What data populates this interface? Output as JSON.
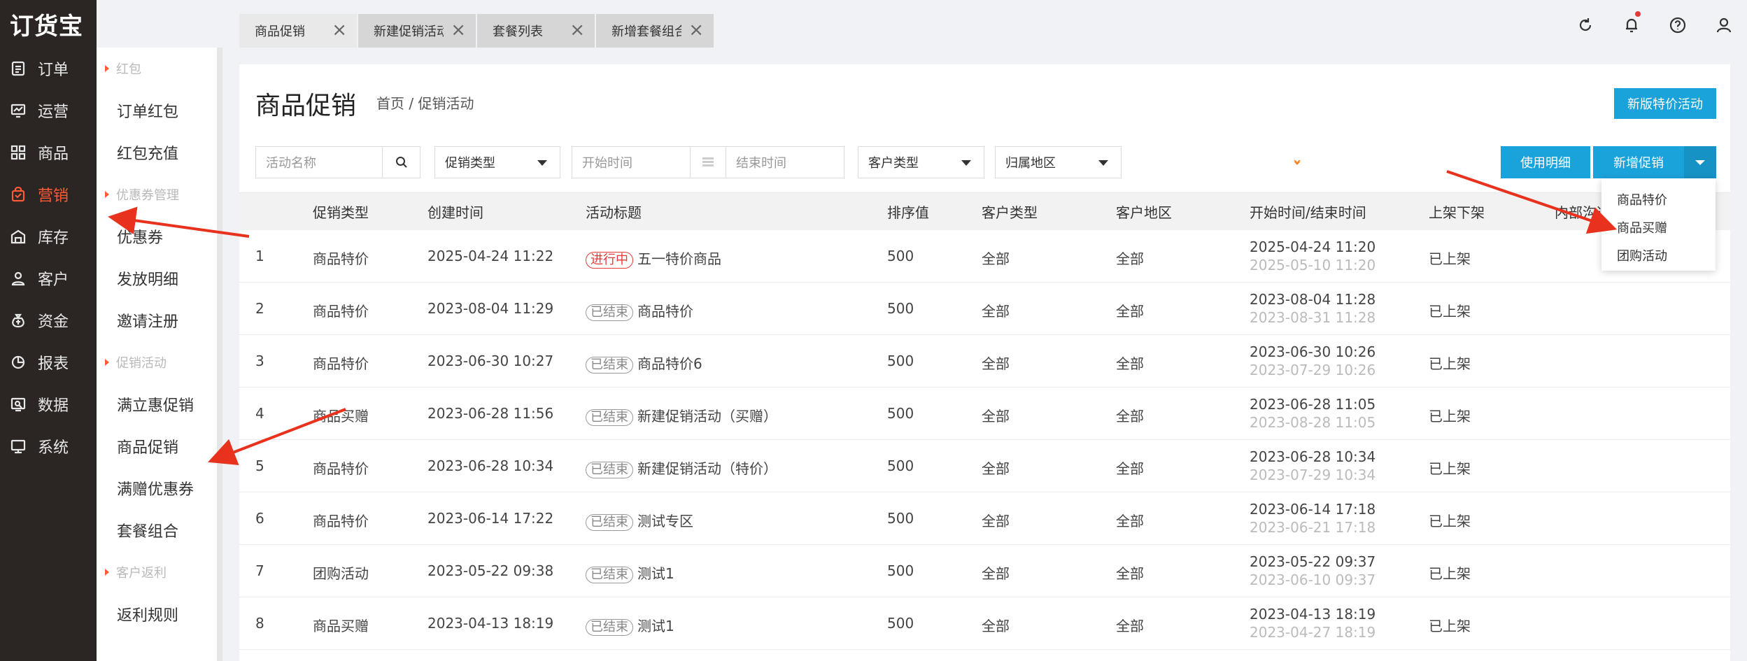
{
  "app": {
    "logo": "订货宝"
  },
  "nav": [
    {
      "label": "订单",
      "icon": "order-icon"
    },
    {
      "label": "运营",
      "icon": "chart-board-icon"
    },
    {
      "label": "商品",
      "icon": "grid-icon"
    },
    {
      "label": "营销",
      "icon": "bag-icon",
      "active": true
    },
    {
      "label": "库存",
      "icon": "warehouse-icon"
    },
    {
      "label": "客户",
      "icon": "user-icon"
    },
    {
      "label": "资金",
      "icon": "money-bag-icon"
    },
    {
      "label": "报表",
      "icon": "pie-icon"
    },
    {
      "label": "数据",
      "icon": "data-icon"
    },
    {
      "label": "系统",
      "icon": "monitor-icon"
    }
  ],
  "submenu": {
    "g1": "红包",
    "g1_items": [
      "订单红包",
      "红包充值"
    ],
    "g2": "优惠券管理",
    "g2_items": [
      "优惠券",
      "发放明细",
      "邀请注册"
    ],
    "g3": "促销活动",
    "g3_items": [
      "满立惠促销",
      "商品促销",
      "满赠优惠券",
      "套餐组合"
    ],
    "g4": "客户返利",
    "g4_items": [
      "返利规则"
    ]
  },
  "tabs": [
    "商品促销",
    "新建促销活动",
    "套餐列表",
    "新增套餐组合"
  ],
  "header": {
    "title": "商品促销",
    "breadcrumb": "首页 / 促销活动",
    "new_special": "新版特价活动"
  },
  "filters": {
    "name_placeholder": "活动名称",
    "type": "促销类型",
    "start": "开始时间",
    "end": "结束时间",
    "customer_type": "客户类型",
    "region": "归属地区"
  },
  "actions": {
    "usage": "使用明细",
    "add": "新增促销"
  },
  "dropdown": [
    "商品特价",
    "商品买赠",
    "团购活动"
  ],
  "columns": [
    "促销类型",
    "创建时间",
    "活动标题",
    "排序值",
    "客户类型",
    "客户地区",
    "开始时间/结束时间",
    "上架下架",
    "内部沟通"
  ],
  "rows": [
    {
      "no": "1",
      "type": "商品特价",
      "created": "2025-04-24 11:22",
      "status": "进行中",
      "title": "五一特价商品",
      "sort": "500",
      "ctype": "全部",
      "region": "全部",
      "start": "2025-04-24 11:20",
      "end": "2025-05-10 11:20",
      "shelf": "已上架"
    },
    {
      "no": "2",
      "type": "商品特价",
      "created": "2023-08-04 11:29",
      "status": "已结束",
      "title": "商品特价",
      "sort": "500",
      "ctype": "全部",
      "region": "全部",
      "start": "2023-08-04 11:28",
      "end": "2023-08-31 11:28",
      "shelf": "已上架"
    },
    {
      "no": "3",
      "type": "商品特价",
      "created": "2023-06-30 10:27",
      "status": "已结束",
      "title": "商品特价6",
      "sort": "500",
      "ctype": "全部",
      "region": "全部",
      "start": "2023-06-30 10:26",
      "end": "2023-07-29 10:26",
      "shelf": "已上架"
    },
    {
      "no": "4",
      "type": "商品买赠",
      "created": "2023-06-28 11:56",
      "status": "已结束",
      "title": "新建促销活动（买赠）",
      "sort": "500",
      "ctype": "全部",
      "region": "全部",
      "start": "2023-06-28 11:05",
      "end": "2023-08-28 11:05",
      "shelf": "已上架"
    },
    {
      "no": "5",
      "type": "商品特价",
      "created": "2023-06-28 10:34",
      "status": "已结束",
      "title": "新建促销活动（特价）",
      "sort": "500",
      "ctype": "全部",
      "region": "全部",
      "start": "2023-06-28 10:34",
      "end": "2023-07-29 10:34",
      "shelf": "已上架"
    },
    {
      "no": "6",
      "type": "商品特价",
      "created": "2023-06-14 17:22",
      "status": "已结束",
      "title": "测试专区",
      "sort": "500",
      "ctype": "全部",
      "region": "全部",
      "start": "2023-06-14 17:18",
      "end": "2023-06-21 17:18",
      "shelf": "已上架"
    },
    {
      "no": "7",
      "type": "团购活动",
      "created": "2023-05-22 09:38",
      "status": "已结束",
      "title": "测试1",
      "sort": "500",
      "ctype": "全部",
      "region": "全部",
      "start": "2023-05-22 09:37",
      "end": "2023-06-10 09:37",
      "shelf": "已上架"
    },
    {
      "no": "8",
      "type": "商品买赠",
      "created": "2023-04-13 18:19",
      "status": "已结束",
      "title": "测试1",
      "sort": "500",
      "ctype": "全部",
      "region": "全部",
      "start": "2023-04-13 18:19",
      "end": "2023-04-27 18:19",
      "shelf": "已上架"
    }
  ],
  "colors": {
    "accent": "#ff5a36",
    "primary": "#1aa3db",
    "nav_bg": "#2b2523",
    "annotation": "#e8321e"
  }
}
